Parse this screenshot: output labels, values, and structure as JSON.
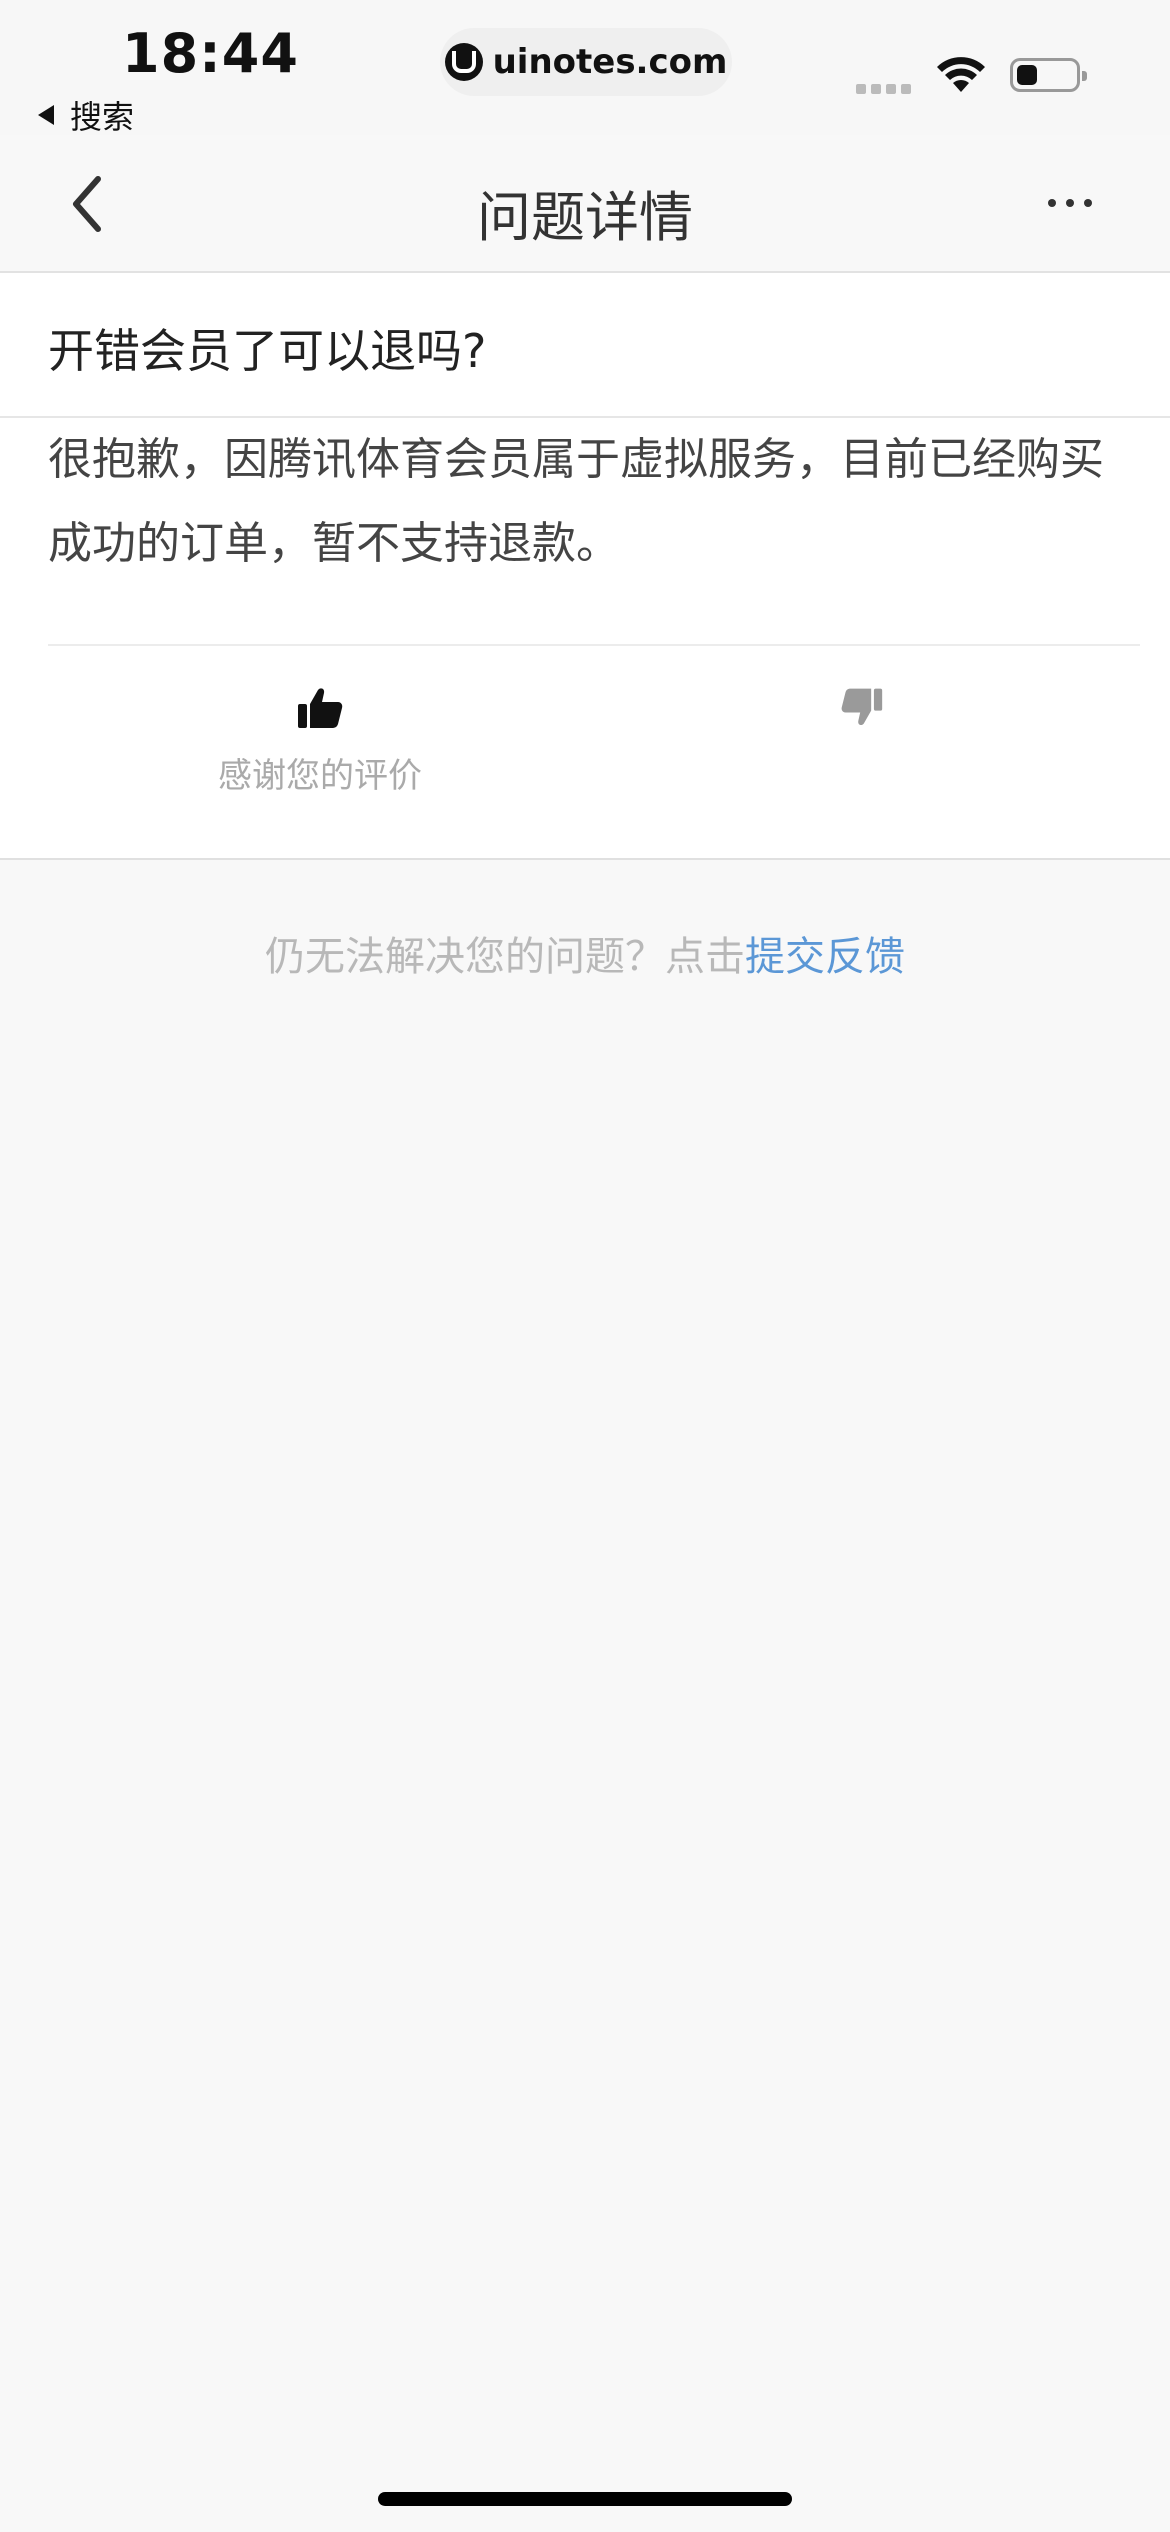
{
  "status_bar": {
    "time": "18:44",
    "back_app_label": "搜索",
    "url": "uinotes.com",
    "battery_level": 0.35
  },
  "nav": {
    "title": "问题详情"
  },
  "question": {
    "text": "开错会员了可以退吗?"
  },
  "answer": {
    "text": "很抱歉，因腾讯体育会员属于虚拟服务，目前已经购买成功的订单，暂不支持退款。",
    "feedback_thanks": "感谢您的评价"
  },
  "hint": {
    "prefix": "仍无法解决您的问题？点击",
    "link": "提交反馈"
  },
  "colors": {
    "link": "#5b97d6",
    "background": "#f8f8f8"
  }
}
